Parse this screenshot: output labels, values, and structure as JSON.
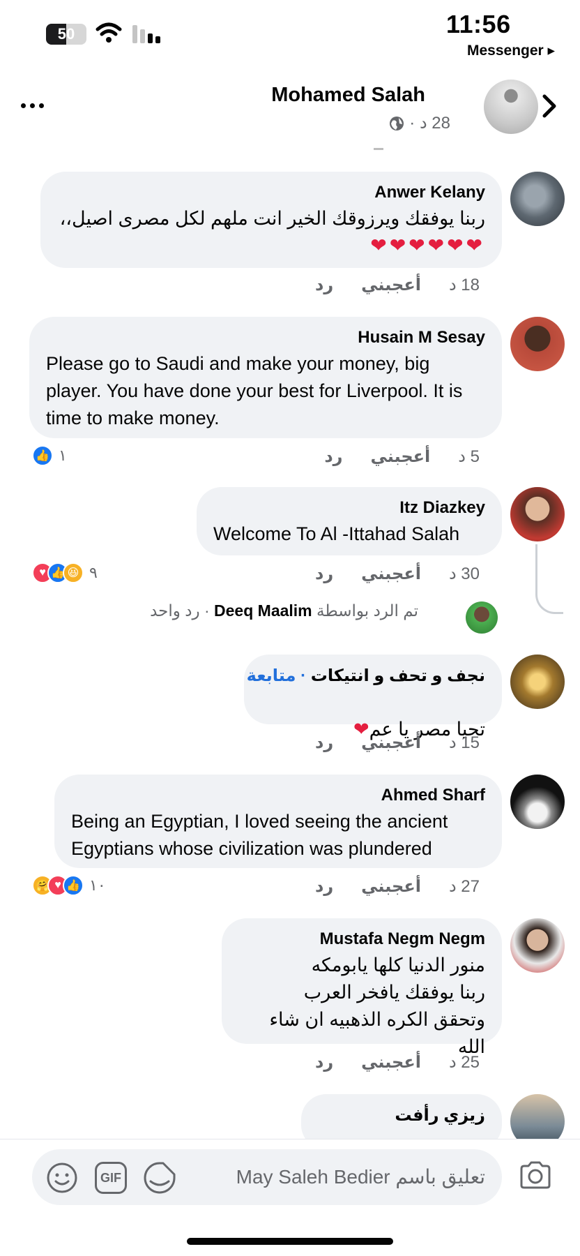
{
  "status_bar": {
    "battery_level": "50",
    "time": "11:56",
    "back_app": "Messenger ▸"
  },
  "header": {
    "page_name": "Mohamed Salah",
    "post_time": "28 د ·",
    "verified": true
  },
  "comments": [
    {
      "author": "Anwer Kelany",
      "text": "ربنا يوفقك ويرزوقك الخير انت ملهم لكل مصرى اصيل،،",
      "extra": "❤❤❤❤❤❤",
      "time": "18 د",
      "like": "أعجبني",
      "reply": "رد"
    },
    {
      "author": "Husain M Sesay",
      "text": "Please go to Saudi and make your money, big player. You have done your best for Liverpool. It is time to make money.",
      "time": "5 د",
      "like": "أعجبني",
      "reply": "رد",
      "reaction_count": "١"
    },
    {
      "author": "Itz Diazkey",
      "text": "Welcome To Al -Ittahad Salah",
      "time": "30 د",
      "like": "أعجبني",
      "reply": "رد",
      "reaction_count": "٩",
      "replied_prefix": "تم الرد بواسطة",
      "replied_by": "Deeq Maalim",
      "replied_suffix": "· رد واحد"
    },
    {
      "author": "نجف و تحف و انتيكات",
      "follow": "· متابعة",
      "text": "تحيا مصر يا عم",
      "extra": "❤",
      "time": "15 د",
      "like": "أعجبني",
      "reply": "رد"
    },
    {
      "author": "Ahmed Sharf",
      "text": "Being an Egyptian, I loved seeing the ancient Egyptians whose civilization was plundered",
      "time": "27 د",
      "like": "أعجبني",
      "reply": "رد",
      "reaction_count": "١٠"
    },
    {
      "author": "Mustafa Negm Negm",
      "text": "منور الدنيا كلها يابومكه\nربنا يوفقك يافخر العرب\nوتحقق الكره الذهبيه ان شاء الله",
      "time": "25 د",
      "like": "أعجبني",
      "reply": "رد"
    },
    {
      "author": "زيزي رأفت"
    }
  ],
  "composer": {
    "placeholder": "تعليق باسم May Saleh Bedier",
    "gif_label": "GIF"
  },
  "colors": {
    "bubble": "#f0f2f5",
    "link": "#216fdb",
    "muted": "#65676b",
    "like_blue": "#1877f2",
    "heart_red": "#e41e3f"
  }
}
